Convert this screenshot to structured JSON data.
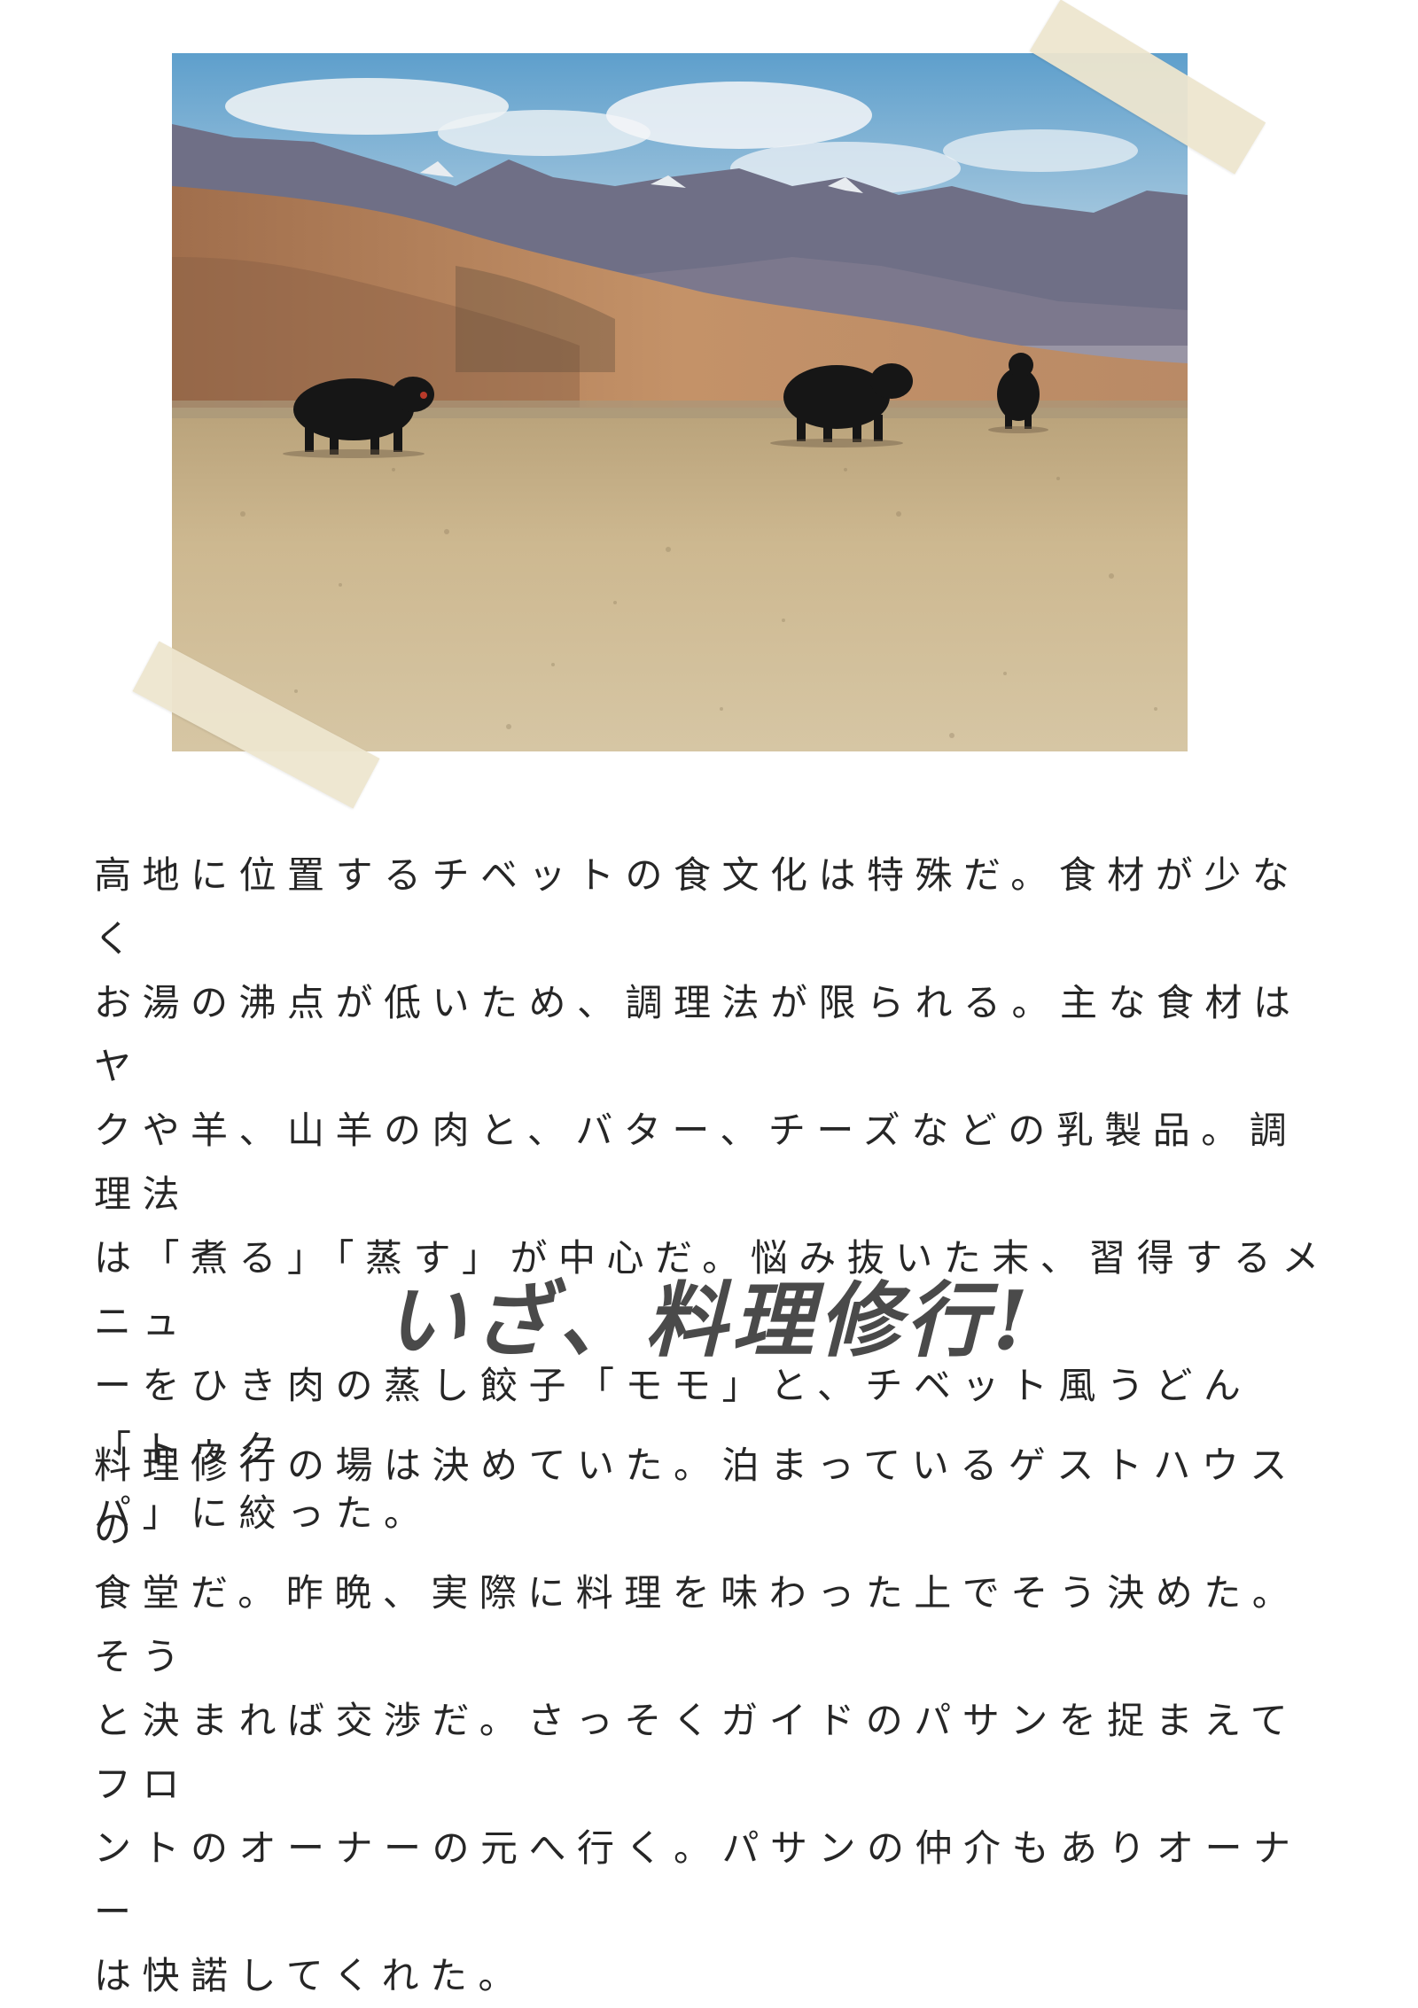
{
  "photo": {
    "subject": "yaks on a high plateau with mountains",
    "colors": {
      "sky": "#86b4d4",
      "ground": "#c9b48c",
      "mountain": "#6f6f86",
      "hill": "#b8875a",
      "yak": "#161616"
    }
  },
  "paragraph1": {
    "lines": [
      "高地に位置するチベットの食文化は特殊だ。食材が少なく",
      "お湯の沸点が低いため、調理法が限られる。主な食材はヤ",
      "クや羊、山羊の肉と、バター、チーズなどの乳製品。調理法",
      "は「煮る」「蒸す」が中心だ。悩み抜いた末、習得するメニュ",
      "ーをひき肉の蒸し餃子「モモ」と、チベット風うどん「トゥク",
      "パ」に絞った。"
    ]
  },
  "heading": {
    "text": "いざ、料理修行!"
  },
  "paragraph2": {
    "lines": [
      "料理修行の場は決めていた。泊まっているゲストハウスの",
      "食堂だ。昨晩、実際に料理を味わった上でそう決めた。そう",
      "と決まれば交渉だ。さっそくガイドのパサンを捉まえてフロ",
      "ントのオーナーの元へ行く。パサンの仲介もありオーナー",
      "は快諾してくれた。"
    ]
  }
}
